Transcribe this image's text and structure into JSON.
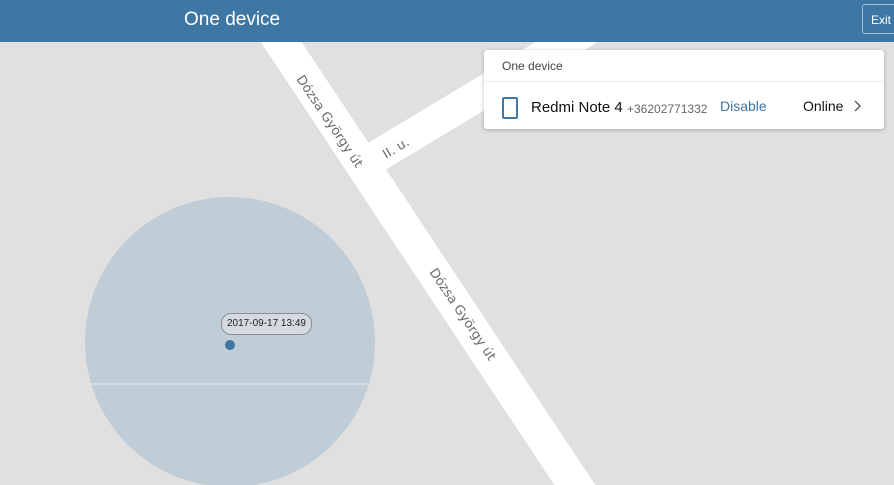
{
  "header": {
    "title": "One device",
    "exit_label": "Exit"
  },
  "map": {
    "streets": [
      {
        "name": "Dózsa György út"
      },
      {
        "name": "Dózsa György út"
      },
      {
        "name": "II. u."
      }
    ],
    "timestamp": "2017-09-17 13:49",
    "colors": {
      "map_background": "#e0e0e0",
      "road": "#ffffff",
      "accuracy_circle": "#c1cdd6",
      "location_dot": "#3e77a3"
    }
  },
  "panel": {
    "title": "One device",
    "device": {
      "icon": "phone-icon",
      "name": "Redmi Note 4",
      "phone": "+36202771332",
      "action_label": "Disable",
      "status": "Online"
    }
  },
  "colors": {
    "header": "#3e77a3",
    "accent": "#3e77a3"
  }
}
